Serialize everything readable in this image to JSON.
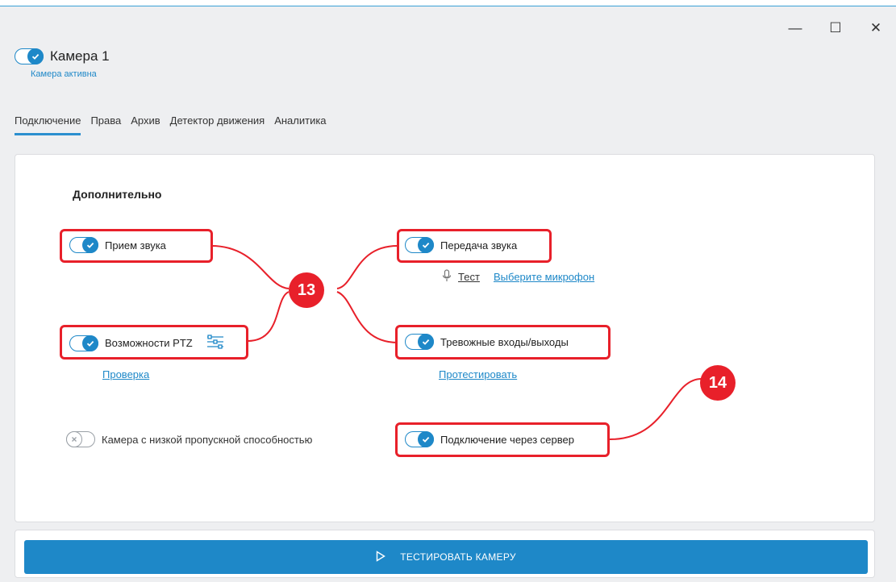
{
  "window": {
    "minimize_label": "—",
    "maximize_label": "☐",
    "close_label": "✕"
  },
  "camera": {
    "name": "Камера 1",
    "status": "Камера активна",
    "enabled": true
  },
  "tabs": [
    {
      "label": "Подключение",
      "active": true
    },
    {
      "label": "Права",
      "active": false
    },
    {
      "label": "Архив",
      "active": false
    },
    {
      "label": "Детектор движения",
      "active": false
    },
    {
      "label": "Аналитика",
      "active": false
    }
  ],
  "section": {
    "title": "Дополнительно"
  },
  "options": {
    "audio_in": {
      "label": "Прием звука",
      "enabled": true
    },
    "audio_out": {
      "label": "Передача звука",
      "enabled": true
    },
    "ptz": {
      "label": "Возможности PTZ",
      "enabled": true,
      "link": "Проверка"
    },
    "alarm_io": {
      "label": "Тревожные входы/выходы",
      "enabled": true,
      "link": "Протестировать"
    },
    "low_bandwidth": {
      "label": "Камера с низкой пропускной способностью",
      "enabled": false
    },
    "via_server": {
      "label": "Подключение через сервер",
      "enabled": true
    }
  },
  "microphone": {
    "test_label": "Тест",
    "select_label": "Выберите микрофон"
  },
  "callouts": {
    "a": "13",
    "b": "14"
  },
  "footer": {
    "test_camera_label": "ТЕСТИРОВАТЬ КАМЕРУ"
  },
  "colors": {
    "accent": "#1e88c8",
    "highlight": "#e8202a"
  }
}
